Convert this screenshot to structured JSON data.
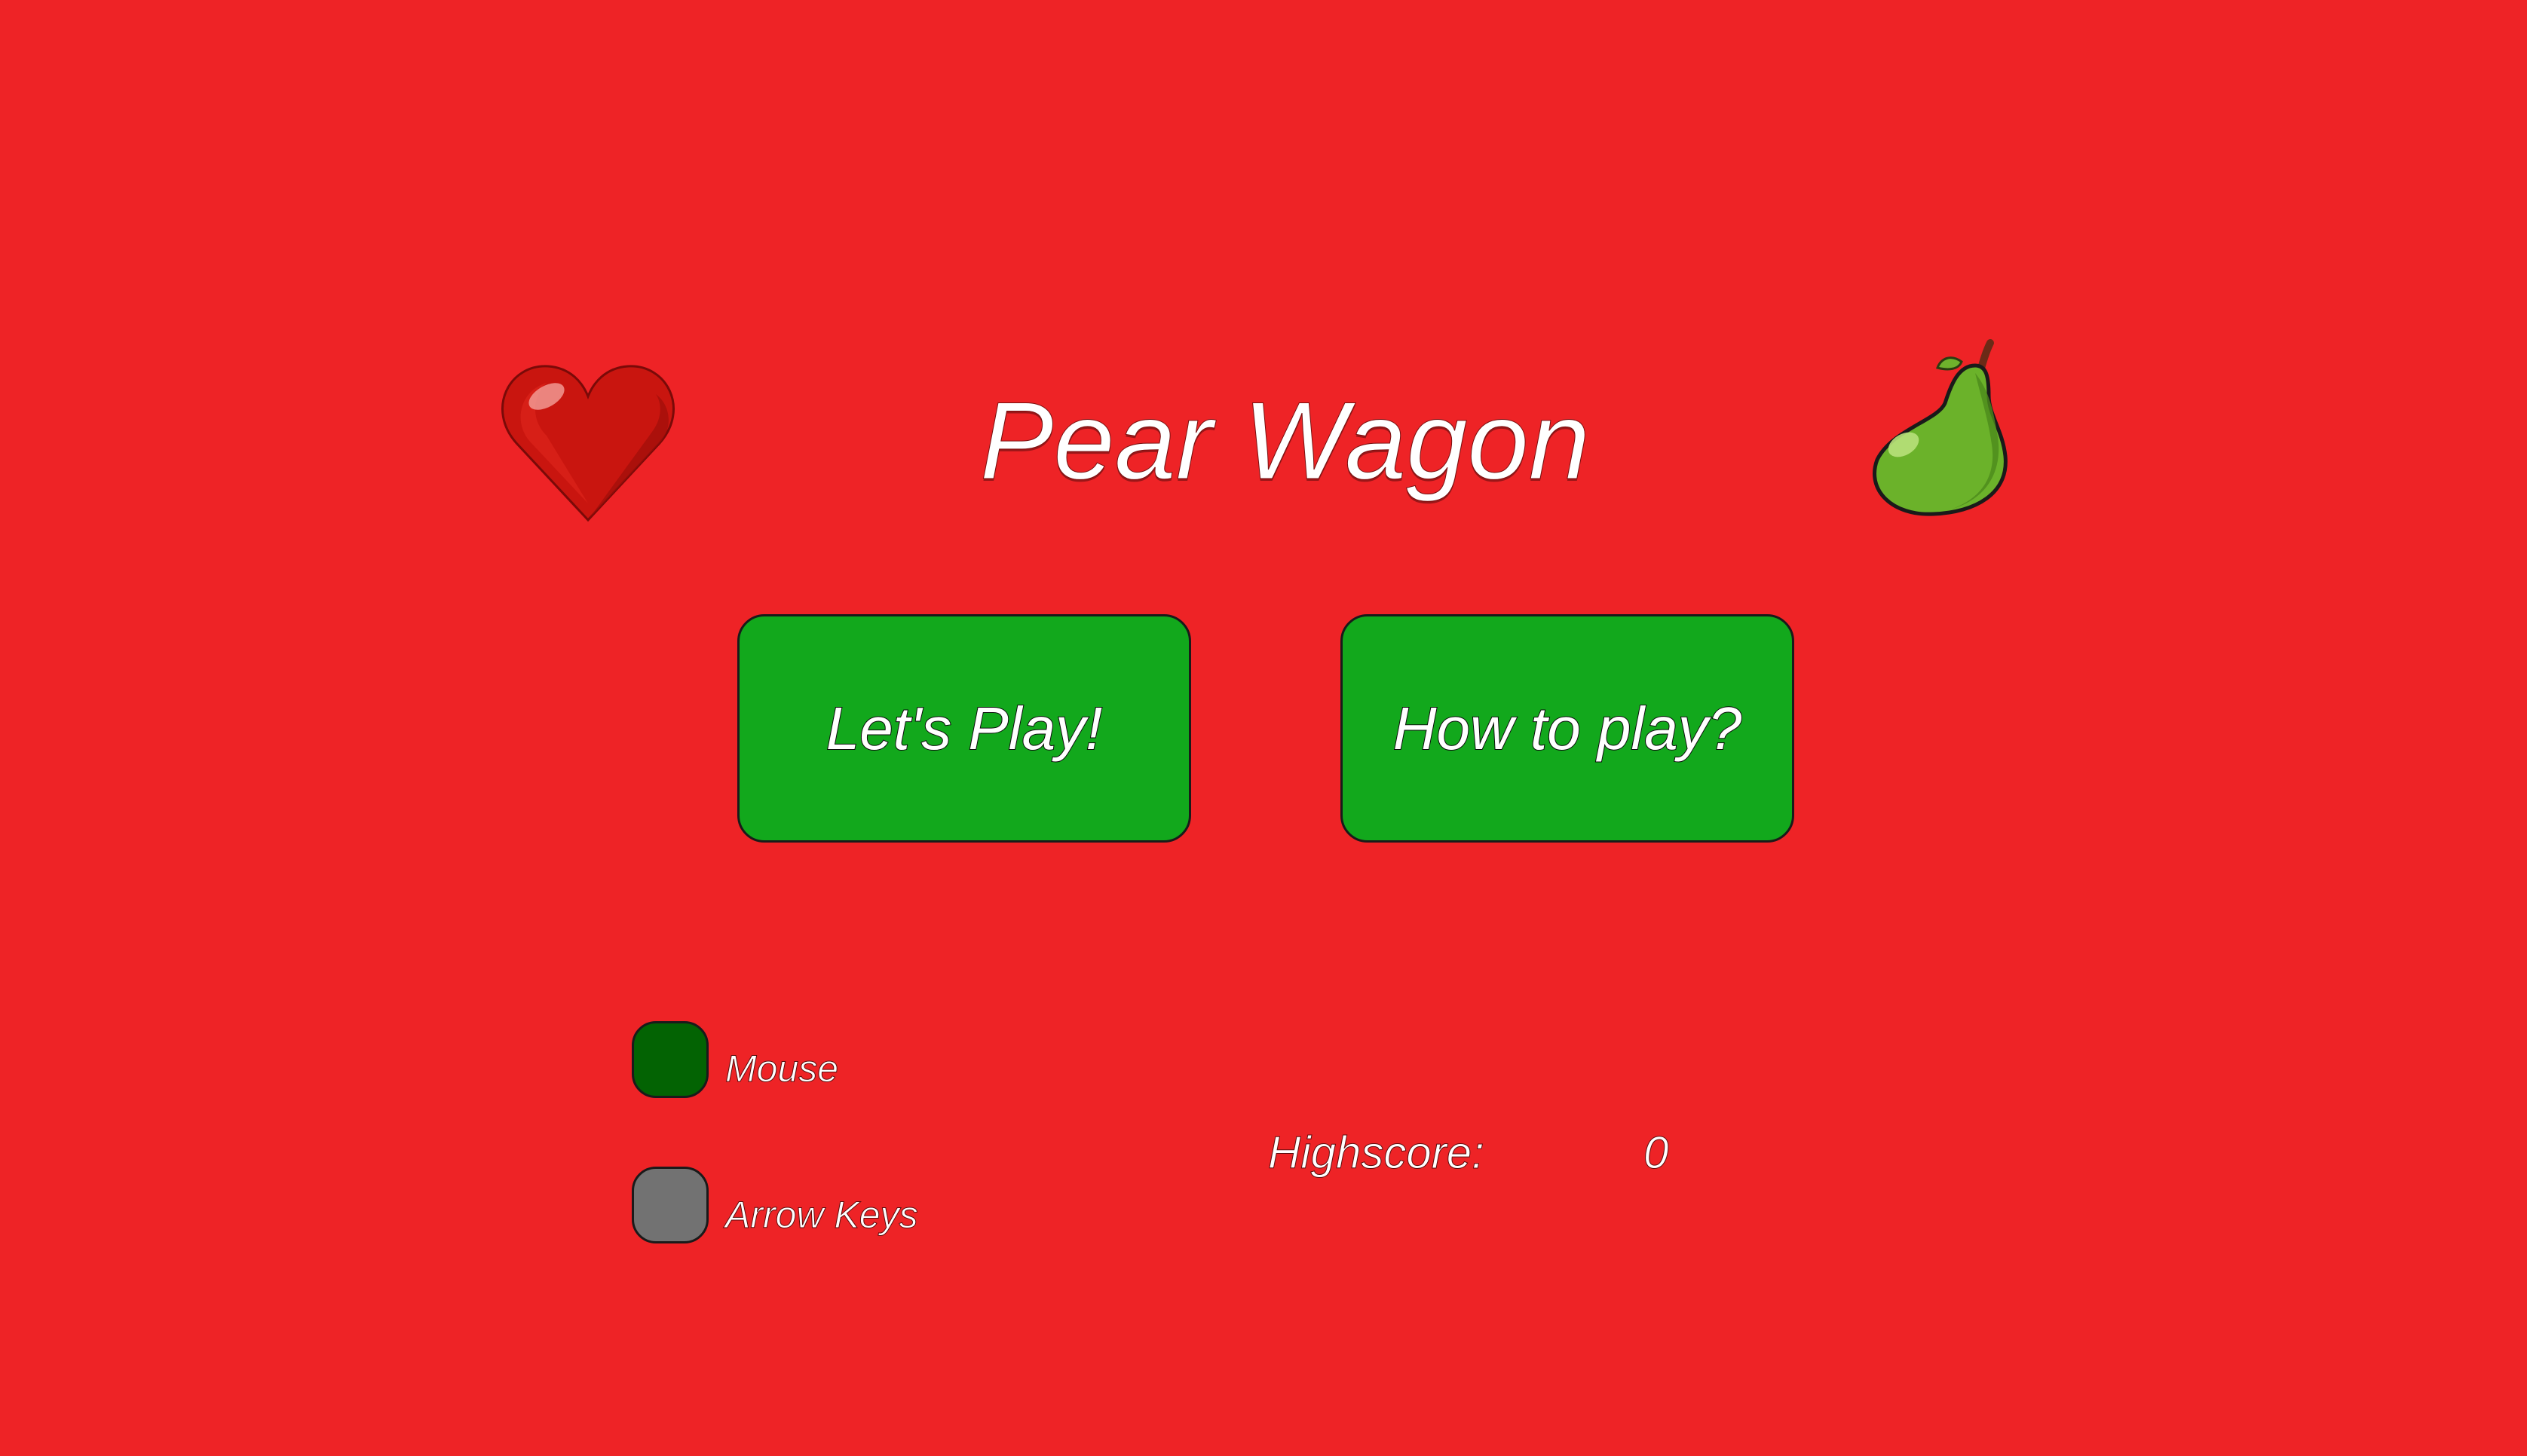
{
  "game": {
    "title": "Pear Wagon",
    "background_color": "#ee2326",
    "icons": {
      "left": "heart-icon",
      "right": "pear-icon"
    }
  },
  "menu": {
    "play_label": "Let's Play!",
    "howto_label": "How to play?",
    "button_color": "#12a81c"
  },
  "controls": {
    "options": [
      {
        "label": "Mouse",
        "selected": true,
        "color": "#036303"
      },
      {
        "label": "Arrow Keys",
        "selected": false,
        "color": "#727272"
      }
    ]
  },
  "highscore": {
    "label": "Highscore:",
    "value": "0"
  }
}
